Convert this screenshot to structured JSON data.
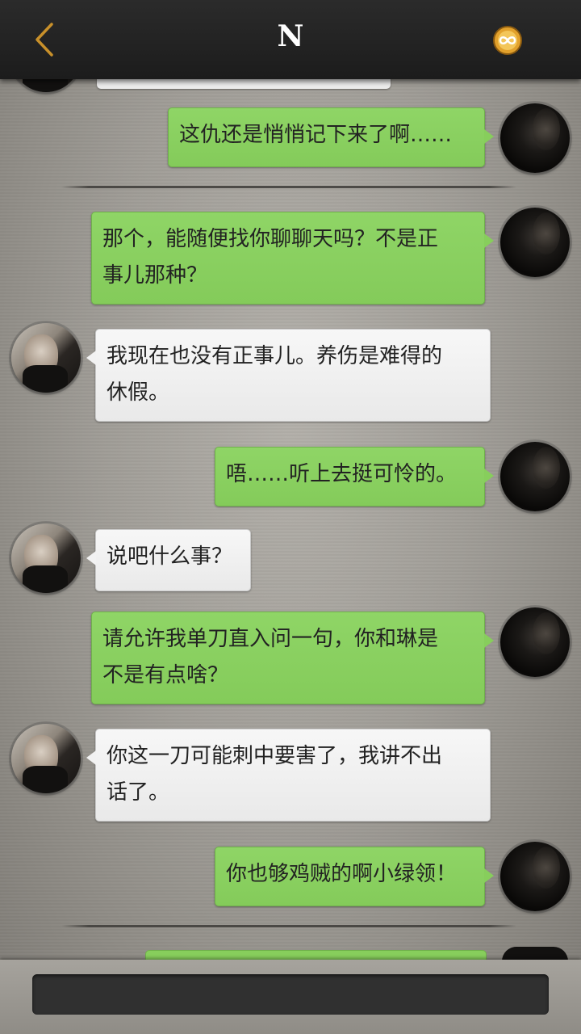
{
  "header": {
    "title": "N",
    "back_icon": "chevron-left-icon",
    "badge_icon": "infinity-badge-icon",
    "accent_color": "#c8902a"
  },
  "messages": [
    {
      "side": "out",
      "lines": [
        "这仇还是悄悄记下来了啊……"
      ]
    },
    {
      "side": "out",
      "lines": [
        "那个，能随便找你聊聊天吗？不是正",
        "事儿那种？"
      ]
    },
    {
      "side": "in",
      "lines": [
        "我现在也没有正事儿。养伤是难得的",
        "休假。"
      ]
    },
    {
      "side": "out",
      "lines": [
        "唔……听上去挺可怜的。"
      ]
    },
    {
      "side": "in",
      "lines": [
        "说吧什么事？"
      ]
    },
    {
      "side": "out",
      "lines": [
        "请允许我单刀直入问一句，你和琳是",
        "不是有点啥？"
      ]
    },
    {
      "side": "in",
      "lines": [
        "你这一刀可能刺中要害了，我讲不出",
        "话了。"
      ]
    },
    {
      "side": "out",
      "lines": [
        "你也够鸡贼的啊小绿领！"
      ]
    }
  ],
  "colors": {
    "outgoing_bubble": "#87ce5c",
    "incoming_bubble": "#f2f2f2",
    "header_bg": "#222222"
  }
}
